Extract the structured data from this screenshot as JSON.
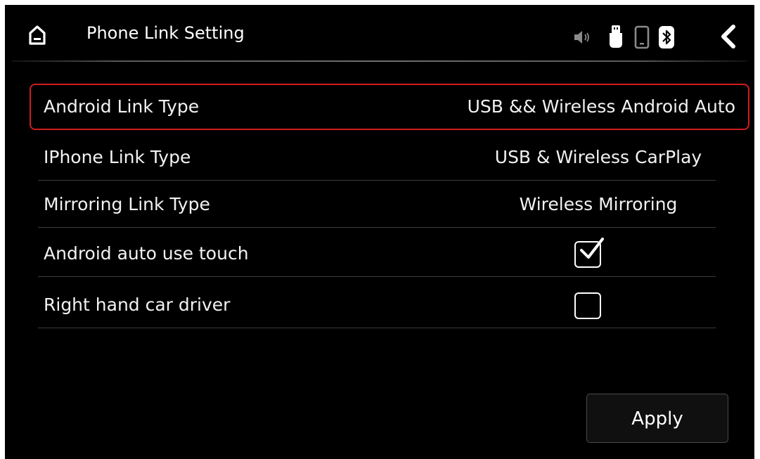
{
  "header": {
    "title": "Phone Link Setting",
    "icons": [
      "home-icon",
      "volume-icon",
      "usb-icon",
      "phone-icon",
      "bluetooth-icon",
      "back-icon"
    ]
  },
  "settings": {
    "rows": [
      {
        "label": "Android Link Type",
        "value": "USB && Wireless Android Auto",
        "selected": true
      },
      {
        "label": "IPhone Link Type",
        "value": "USB & Wireless CarPlay"
      },
      {
        "label": "Mirroring Link Type",
        "value": "Wireless Mirroring"
      },
      {
        "label": "Android auto use touch",
        "checked": true
      },
      {
        "label": "Right hand car driver",
        "checked": false
      }
    ]
  },
  "apply_label": "Apply",
  "colors": {
    "background": "#000000",
    "text": "#ffffff",
    "selection_border": "#d01c1c",
    "divider": "#3a3a3a"
  }
}
